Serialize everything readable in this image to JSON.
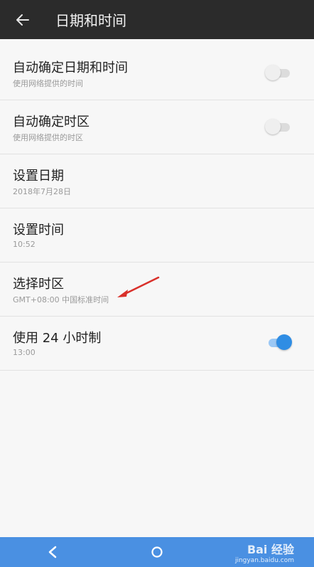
{
  "header": {
    "title": "日期和时间",
    "back_icon": "arrow-left-icon"
  },
  "settings": [
    {
      "title": "自动确定日期和时间",
      "subtitle": "使用网络提供的时间",
      "toggle": "off"
    },
    {
      "title": "自动确定时区",
      "subtitle": "使用网络提供的时区",
      "toggle": "off"
    },
    {
      "title": "设置日期",
      "subtitle": "2018年7月28日"
    },
    {
      "title": "设置时间",
      "subtitle": "10:52"
    },
    {
      "title": "选择时区",
      "subtitle": "GMT+08:00 中国标准时间"
    },
    {
      "title": "使用 24 小时制",
      "subtitle": "13:00",
      "toggle": "on"
    }
  ],
  "navbar": {
    "back_icon": "back-icon",
    "home_icon": "home-icon",
    "watermark": {
      "brand": "Bai 经验",
      "url": "jingyan.baidu.com"
    }
  },
  "colors": {
    "appbar": "#2b2b2b",
    "navbar": "#4a90e2",
    "accent": "#2f8de4",
    "arrow": "#d9302a"
  }
}
